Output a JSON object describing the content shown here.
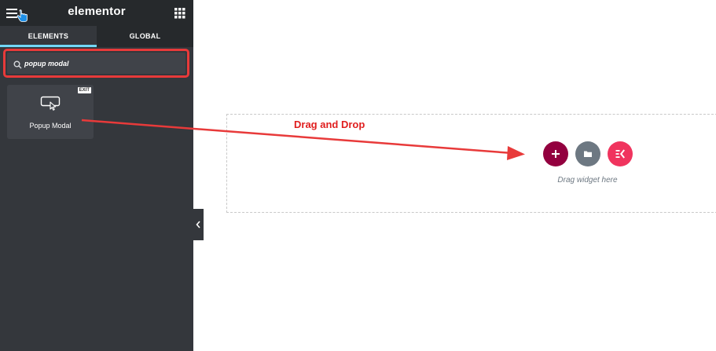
{
  "panel": {
    "brand": "elementor",
    "tabs": [
      {
        "label": "ELEMENTS",
        "active": true
      },
      {
        "label": "GLOBAL",
        "active": false
      }
    ],
    "search": {
      "value": "popup modal",
      "placeholder": "Search Widget..."
    },
    "widgets": [
      {
        "label": "Popup Modal",
        "badge": "EXIT",
        "icon": "popup-modal-icon"
      }
    ]
  },
  "canvas": {
    "annotation": "Drag and Drop",
    "drop_hint": "Drag widget here",
    "buttons": [
      "add-section",
      "add-template",
      "elementskit"
    ]
  },
  "colors": {
    "panel_bg": "#34373c",
    "topbar_bg": "#26292c",
    "tab_active_accent": "#71d7f7",
    "highlight": "#e83a3a",
    "add_button": "#93003f",
    "folder_button": "#6d7882",
    "ek_button": "#f0345e"
  }
}
